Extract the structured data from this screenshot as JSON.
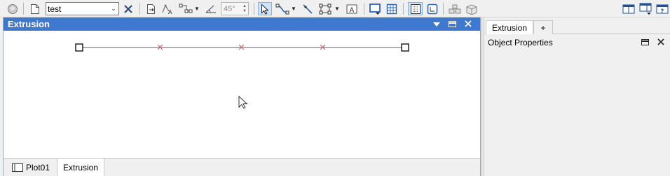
{
  "toolbar": {
    "project_combo": {
      "value": "test",
      "options_visible": [
        "test"
      ]
    },
    "angle_field": {
      "value": "45°"
    },
    "buttons": [
      "open-circle-icon",
      "new-document-icon",
      "delete-icon",
      "document-export-icon",
      "polyline-text-icon",
      "node-path-icon",
      "angle-icon",
      "pointer-select-icon",
      "connect-line-icon",
      "cut-line-icon",
      "rectangle-select-icon",
      "text-box-icon",
      "shape-dropdown-icon",
      "grid-view-icon",
      "snap-grid-icon",
      "frame-icon",
      "stacked-blocks-icon",
      "package-icon",
      "layout-panels-icon",
      "layout-panel-down-icon",
      "help-icon"
    ]
  },
  "left_dock": {
    "title": "Extrusion",
    "bottom_tabs": [
      {
        "label": "Plot01",
        "selected": false
      },
      {
        "label": "Extrusion",
        "selected": true
      }
    ]
  },
  "canvas": {
    "line_color": "#7f7f7f",
    "marker_color": "#e05050",
    "handle_count": 2,
    "marker_count": 3
  },
  "right_panel": {
    "tabs": [
      {
        "label": "Extrusion",
        "selected": true
      },
      {
        "label": "+",
        "selected": false
      }
    ],
    "section_title": "Object Properties"
  },
  "colors": {
    "title_bar": "#3f78cf",
    "accent_icon": "#2a64c0"
  }
}
